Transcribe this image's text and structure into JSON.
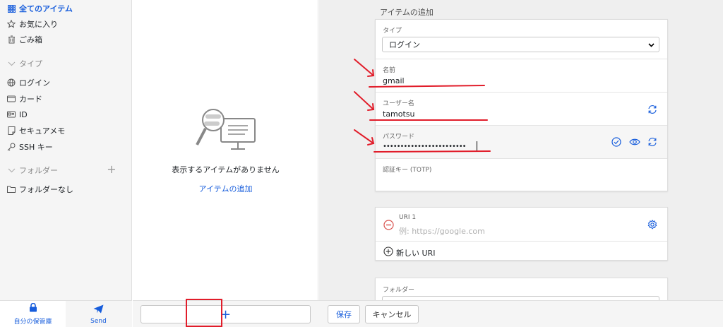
{
  "sidebar": {
    "all_items": "全てのアイテム",
    "favorites": "お気に入り",
    "trash": "ごみ箱",
    "types_heading": "タイプ",
    "type_login": "ログイン",
    "type_card": "カード",
    "type_id": "ID",
    "type_securenote": "セキュアメモ",
    "type_ssh": "SSH キー",
    "folders_heading": "フォルダー",
    "no_folder": "フォルダーなし"
  },
  "bottom_nav": {
    "vault": "自分の保管庫",
    "send": "Send"
  },
  "middle": {
    "empty_text": "表示するアイテムがありません",
    "add_link": "アイテムの追加"
  },
  "bottom_bar": {
    "plus": "+",
    "save": "保存",
    "cancel": "キャンセル"
  },
  "form": {
    "title": "アイテムの追加",
    "type_label": "タイプ",
    "type_value": "ログイン",
    "name_label": "名前",
    "name_value": "gmail",
    "username_label": "ユーザー名",
    "username_value": "tamotsu",
    "password_label": "パスワード",
    "password_value": "••••••••••••••••••••••••",
    "totp_label": "認証キー (TOTP)",
    "uri_label": "URI 1",
    "uri_placeholder": "例: https://google.com",
    "new_uri": "新しい URI",
    "folder_label": "フォルダー"
  },
  "colors": {
    "accent": "#175ddc",
    "annotation": "#e11d2a",
    "remove": "#d9534f"
  }
}
